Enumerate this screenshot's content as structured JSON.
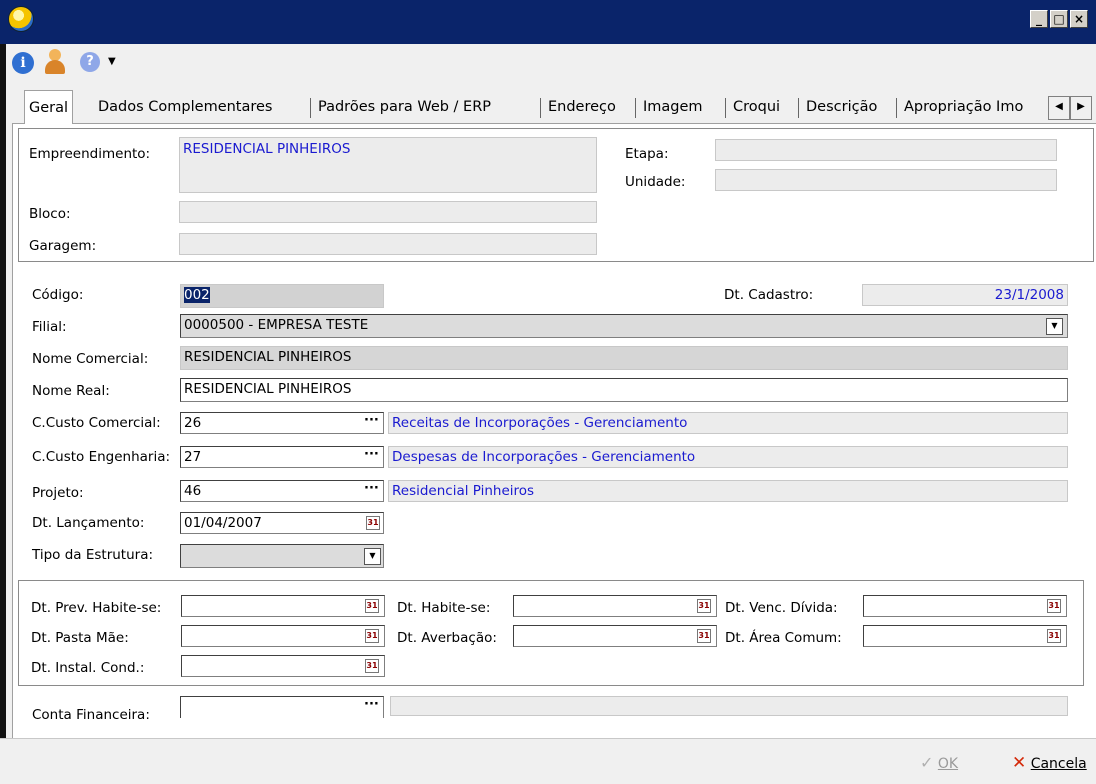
{
  "window": {
    "title": "",
    "minimize": "_",
    "maximize": "□",
    "close": "×"
  },
  "toolbar": {
    "info_icon": "i",
    "help_icon": "?",
    "help_menu_caret": "▼"
  },
  "tabs": [
    {
      "label": "Geral",
      "active": true
    },
    {
      "label": "Dados Complementares"
    },
    {
      "label": "Padrões para Web / ERP"
    },
    {
      "label": "Endereço"
    },
    {
      "label": "Imagem"
    },
    {
      "label": "Croqui"
    },
    {
      "label": "Descrição"
    },
    {
      "label": "Apropriação Imo"
    }
  ],
  "tab_scroll": {
    "left": "◀",
    "right": "▶"
  },
  "header_group": {
    "empreendimento_label": "Empreendimento:",
    "empreendimento_value": "RESIDENCIAL PINHEIROS",
    "etapa_label": "Etapa:",
    "etapa_value": "",
    "unidade_label": "Unidade:",
    "unidade_value": "",
    "bloco_label": "Bloco:",
    "bloco_value": "",
    "garagem_label": "Garagem:",
    "garagem_value": ""
  },
  "main_group": {
    "codigo_label": "Código:",
    "codigo_value": "002",
    "dt_cadastro_label": "Dt. Cadastro:",
    "dt_cadastro_value": "23/1/2008",
    "filial_label": "Filial:",
    "filial_value": "0000500 - EMPRESA TESTE",
    "nome_comercial_label": "Nome Comercial:",
    "nome_comercial_value": "RESIDENCIAL PINHEIROS",
    "nome_real_label": "Nome Real:",
    "nome_real_value": "RESIDENCIAL PINHEIROS",
    "ccusto_comercial_label": "C.Custo Comercial:",
    "ccusto_comercial_value": "26",
    "ccusto_comercial_desc": "Receitas de Incorporações - Gerenciamento",
    "ccusto_engenharia_label": "C.Custo Engenharia:",
    "ccusto_engenharia_value": "27",
    "ccusto_engenharia_desc": "Despesas de Incorporações - Gerenciamento",
    "projeto_label": "Projeto:",
    "projeto_value": "46",
    "projeto_desc": "Residencial Pinheiros",
    "dt_lancamento_label": "Dt. Lançamento:",
    "dt_lancamento_value": "01/04/2007",
    "tipo_estrutura_label": "Tipo da Estrutura:",
    "tipo_estrutura_value": "",
    "lookup_dots": "···"
  },
  "dates_group": {
    "dt_prev_habitese_label": "Dt. Prev. Habite-se:",
    "dt_habitese_label": "Dt. Habite-se:",
    "dt_venc_divida_label": "Dt. Venc. Dívida:",
    "dt_pasta_mae_label": "Dt. Pasta Mãe:",
    "dt_averbacao_label": "Dt. Averbação:",
    "dt_area_comum_label": "Dt. Área Comum:",
    "dt_instal_cond_label": "Dt. Instal. Cond.:"
  },
  "conta_financeira_label": "Conta Financeira:",
  "buttons": {
    "ok": "OK",
    "cancel": "Cancela"
  }
}
